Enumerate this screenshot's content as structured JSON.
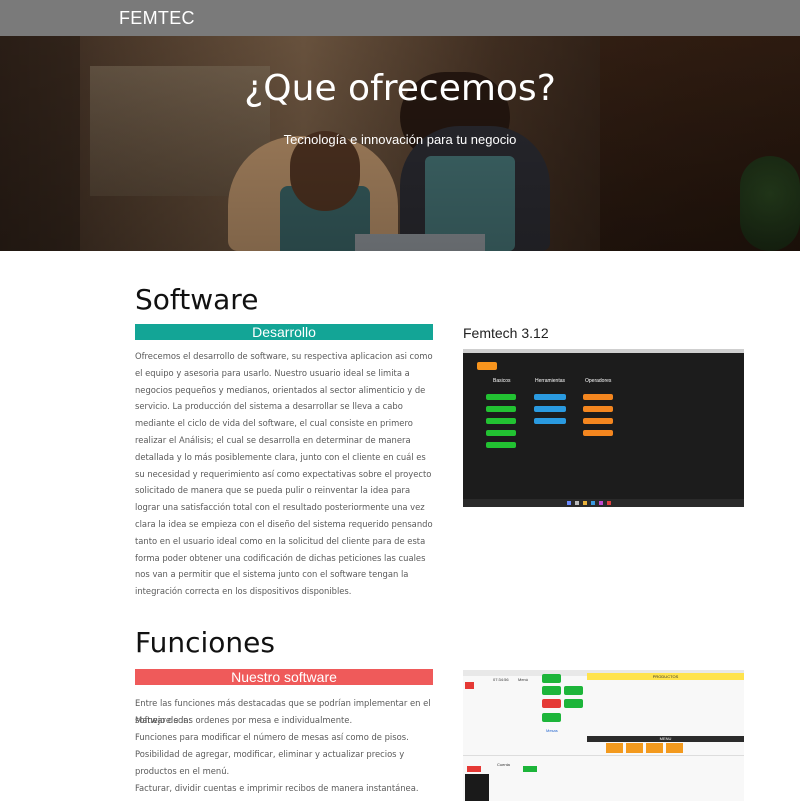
{
  "navbar": {
    "brand": "FEMTEC"
  },
  "hero": {
    "title": "¿Que ofrecemos?",
    "subtitle": "Tecnología e innovación para tu negocio"
  },
  "software": {
    "title": "Software",
    "ribbon": "Desarrollo",
    "paragraph": "Ofrecemos el desarrollo de software, su respectiva aplicacion asi como el equipo y asesoria para usarlo. Nuestro usuario ideal se limita a negocios pequeños y medianos, orientados al sector alimenticio y de servicio. La producción del sistema a desarrollar se lleva a cabo mediante el ciclo de vida del software, el cual consiste en primero realizar el Análisis; el cual se desarrolla en determinar de manera detallada y lo más posiblemente clara, junto con el cliente en cuál es su necesidad y requerimiento así como expectativas sobre el proyecto solicitado de manera que se pueda pulir o reinventar la idea para lograr una satisfacción total con el resultado posteriormente una vez clara la idea se empieza con el diseño del sistema requerido pensando tanto en el usuario ideal como en la solicitud del cliente para de esta forma poder obtener una codificación de dichas peticiones las cuales nos van a permitir que el sistema junto con el software tengan la integración correcta en los dispositivos disponibles.",
    "screenshot_title": "Femtech 3.12",
    "screenshot": {
      "columns": [
        "Basicos",
        "Herramientas",
        "Operadores"
      ],
      "colors": {
        "basicos": "#22c232",
        "herramientas": "#2a9ae0",
        "operadores": "#f4861f",
        "background": "#1c1c1c"
      }
    }
  },
  "funciones": {
    "title": "Funciones",
    "ribbon": "Nuestro software",
    "lines": [
      "Entre las funciones más destacadas que se podrían implementar en el software son:",
      "Manejo de las ordenes por mesa e individualmente.",
      "Funciones para modificar el número de mesas así como de pisos.",
      "Posibilidad de agregar, modificar, eliminar y actualizar precios y productos en el menú.",
      "Facturar, dividir cuentas e imprimir recibos de manera instantánea."
    ],
    "screenshot": {
      "productos_label": "PRODUCTOS",
      "menu_label": "MENU",
      "mesas_label": "Mesas",
      "cuenta_label": "Cuenta",
      "time": "07:34:56",
      "menu_tab": "Menú"
    }
  },
  "colors": {
    "navbar": "#7a7a7a",
    "teal": "#13a596",
    "red": "#ef5a5a"
  }
}
